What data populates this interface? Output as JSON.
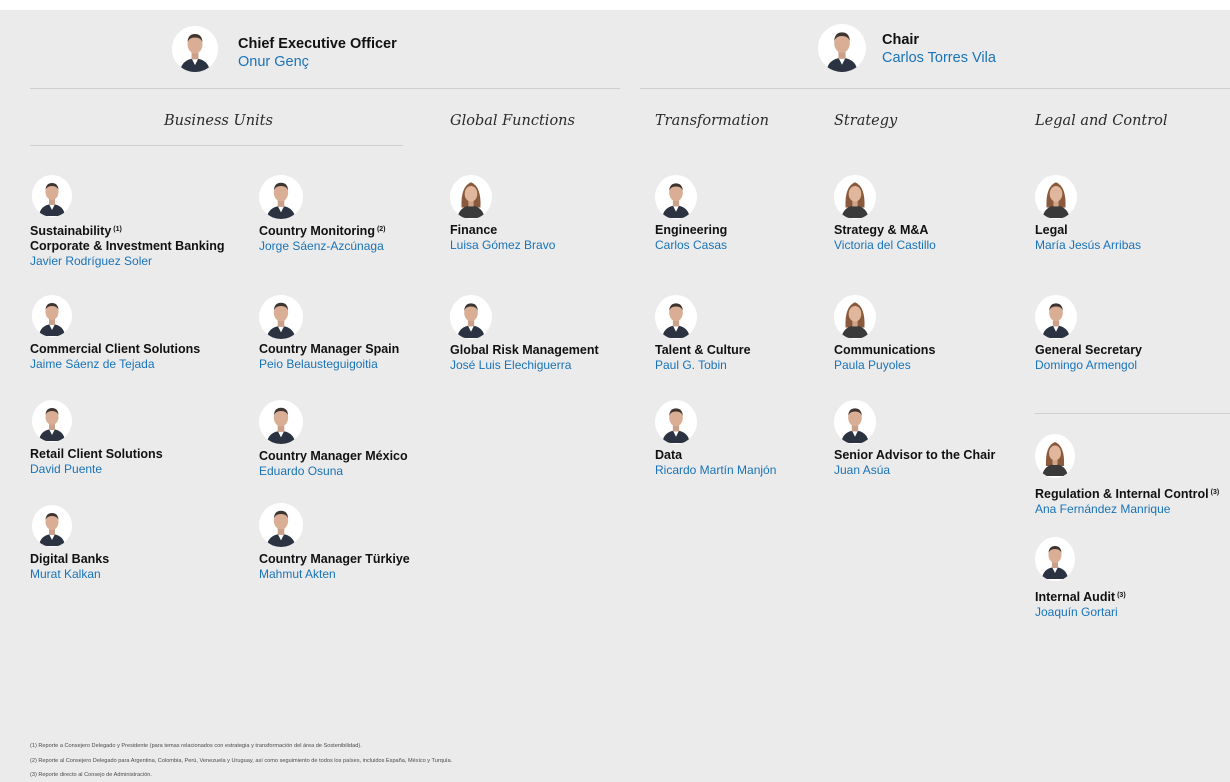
{
  "header": {
    "ceo": {
      "title": "Chief Executive Officer",
      "name": "Onur Genç"
    },
    "chair": {
      "title": "Chair",
      "name": "Carlos Torres Vila"
    }
  },
  "sections": {
    "business_units": "Business Units",
    "global_functions": "Global Functions",
    "transformation": "Transformation",
    "strategy": "Strategy",
    "legal_control": "Legal and Control"
  },
  "people": {
    "sustainability": {
      "title": "Sustainability",
      "sup": "(1)",
      "title2": "Corporate & Investment Banking",
      "name": "Javier Rodríguez Soler"
    },
    "country_monitoring": {
      "title": "Country Monitoring",
      "sup": "(2)",
      "name": "Jorge Sáenz-Azcúnaga"
    },
    "commercial": {
      "title": "Commercial Client Solutions",
      "name": "Jaime Sáenz de Tejada"
    },
    "cm_spain": {
      "title": "Country Manager Spain",
      "name": "Peio Belausteguigoitia"
    },
    "retail": {
      "title": "Retail Client Solutions",
      "name": "David Puente"
    },
    "cm_mexico": {
      "title": "Country Manager México",
      "name": "Eduardo Osuna"
    },
    "digital_banks": {
      "title": "Digital Banks",
      "name": "Murat Kalkan"
    },
    "cm_turkiye": {
      "title": "Country Manager Türkiye",
      "name": "Mahmut Akten"
    },
    "finance": {
      "title": "Finance",
      "name": "Luisa Gómez Bravo"
    },
    "risk": {
      "title": "Global Risk Management",
      "name": "José Luis Elechiguerra"
    },
    "engineering": {
      "title": "Engineering",
      "name": "Carlos Casas"
    },
    "talent": {
      "title": "Talent & Culture",
      "name": "Paul G. Tobin"
    },
    "data": {
      "title": "Data",
      "name": "Ricardo Martín Manjón"
    },
    "strategy_ma": {
      "title": "Strategy & M&A",
      "name": "Victoria del Castillo"
    },
    "communications": {
      "title": "Communications",
      "name": "Paula Puyoles"
    },
    "senior_advisor": {
      "title": "Senior Advisor to the Chair",
      "name": "Juan Asúa"
    },
    "legal": {
      "title": "Legal",
      "name": "María Jesús Arribas"
    },
    "gen_secretary": {
      "title": "General Secretary",
      "name": "Domingo Armengol"
    },
    "regulation": {
      "title": "Regulation & Internal Control",
      "sup": "(3)",
      "name": "Ana Fernández Manrique"
    },
    "internal_audit": {
      "title": "Internal Audit",
      "sup": "(3)",
      "name": "Joaquín Gortari"
    }
  },
  "footnotes": {
    "n1": "(1) Reporte a Consejero Delegado y Presidente (para temas relacionados con estrategia y transformación del área de Sostenibilidad).",
    "n2": "(2) Reporte al Consejero Delegado para Argentina, Colombia, Perú, Venezuela y Uruguay, así como seguimiento de todos los países, incluidos España, México y Turquía.",
    "n3": "(3) Reporte directo al Consejo de Administración."
  },
  "colors": {
    "background": "#ebebeb",
    "name_link": "#1973b8",
    "rule": "#cfcfcf"
  },
  "icons": {
    "portrait": "person-portrait-icon"
  }
}
